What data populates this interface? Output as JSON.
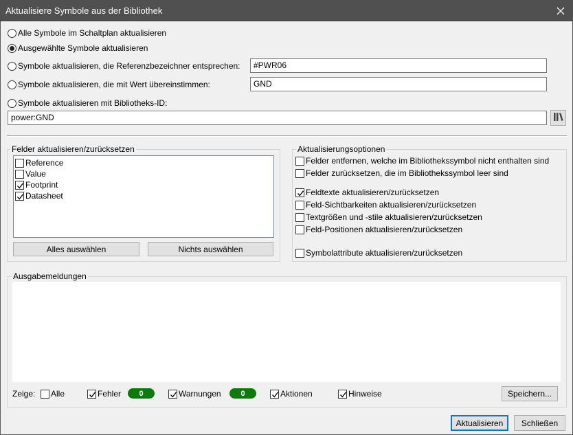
{
  "window": {
    "title": "Aktualisiere Symbole aus der Bibliothek"
  },
  "scope": {
    "all": "Alle Symbole im Schaltplan aktualisieren",
    "selected": "Ausgewählte Symbole aktualisieren",
    "by_reference": "Symbole aktualisieren, die Referenzbezeichner entsprechen:",
    "by_reference_value": "#PWR06",
    "by_value": "Symbole aktualisieren, die mit Wert übereinstimmen:",
    "by_value_value": "GND",
    "by_lib_id": "Symbole aktualisieren mit Bibliotheks-ID:",
    "lib_id_value": "power:GND",
    "selected_option": "selected"
  },
  "fields": {
    "title": "Felder aktualisieren/zurücksetzen",
    "items": [
      {
        "label": "Reference",
        "checked": false
      },
      {
        "label": "Value",
        "checked": false
      },
      {
        "label": "Footprint",
        "checked": true
      },
      {
        "label": "Datasheet",
        "checked": true
      }
    ],
    "select_all": "Alles auswählen",
    "select_none": "Nichts auswählen"
  },
  "options": {
    "title": "Aktualisierungsoptionen",
    "items": [
      {
        "label": "Felder entfernen, welche im Bibliothekssymbol nicht enthalten sind",
        "checked": false
      },
      {
        "label": "Felder zurücksetzen, die im Bibliothekssymbol leer sind",
        "checked": false
      },
      {
        "label": "Feldtexte aktualisieren/zurücksetzen",
        "checked": true
      },
      {
        "label": "Feld-Sichtbarkeiten aktualisieren/zurücksetzen",
        "checked": false
      },
      {
        "label": "Textgrößen und -stile aktualisieren/zurücksetzen",
        "checked": false
      },
      {
        "label": "Feld-Positionen aktualisieren/zurücksetzen",
        "checked": false
      },
      {
        "label": "Symbolattribute aktualisieren/zurücksetzen",
        "checked": false
      }
    ]
  },
  "messages": {
    "title": "Ausgabemeldungen",
    "show_label": "Zeige:",
    "filters": [
      {
        "label": "Alle",
        "checked": false
      },
      {
        "label": "Fehler",
        "checked": true,
        "count": "0"
      },
      {
        "label": "Warnungen",
        "checked": true,
        "count": "0"
      },
      {
        "label": "Aktionen",
        "checked": true
      },
      {
        "label": "Hinweise",
        "checked": true
      }
    ],
    "save_button": "Speichern..."
  },
  "footer": {
    "update_button": "Aktualisieren",
    "close_button": "Schließen"
  },
  "colors": {
    "titlebar": "#505050",
    "badge": "#0e7a0e",
    "default_button_border": "#0078d7"
  }
}
